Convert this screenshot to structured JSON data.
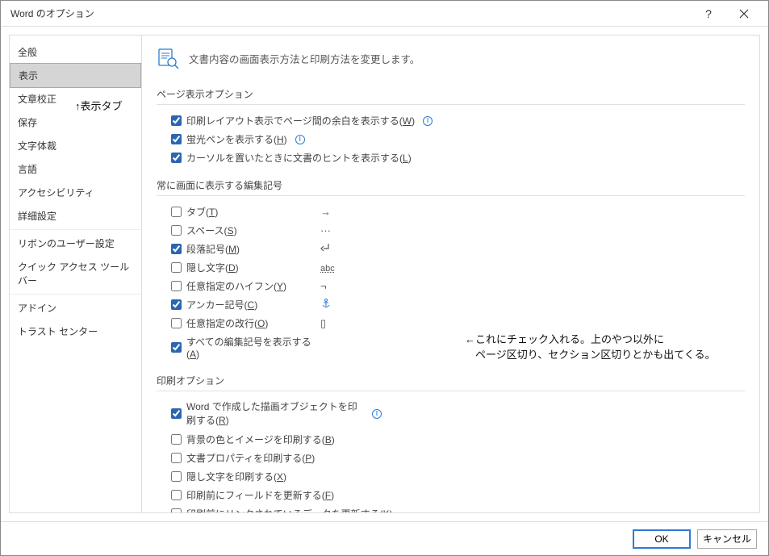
{
  "title": "Word のオプション",
  "sidebar": {
    "groups": [
      [
        "全般",
        "表示",
        "文章校正",
        "保存",
        "文字体裁",
        "言語",
        "アクセシビリティ",
        "詳細設定"
      ],
      [
        "リボンのユーザー設定",
        "クイック アクセス ツール バー"
      ],
      [
        "アドイン",
        "トラスト センター"
      ]
    ],
    "selected": "表示"
  },
  "heading": "文書内容の画面表示方法と印刷方法を変更します。",
  "sections": {
    "page_display": {
      "title": "ページ表示オプション",
      "items": [
        {
          "label_pre": "印刷レイアウト表示でページ間の余白を表示する(",
          "accel": "W",
          "label_post": ")",
          "checked": true,
          "info": true
        },
        {
          "label_pre": "蛍光ペンを表示する(",
          "accel": "H",
          "label_post": ")",
          "checked": true,
          "info": true
        },
        {
          "label_pre": "カーソルを置いたときに文書のヒントを表示する(",
          "accel": "L",
          "label_post": ")",
          "checked": true,
          "info": false
        }
      ]
    },
    "editing_marks": {
      "title": "常に画面に表示する編集記号",
      "items": [
        {
          "label_pre": "タブ(",
          "accel": "T",
          "label_post": ")",
          "checked": false,
          "sym": "→"
        },
        {
          "label_pre": "スペース(",
          "accel": "S",
          "label_post": ")",
          "checked": false,
          "sym": "···"
        },
        {
          "label_pre": "段落記号(",
          "accel": "M",
          "label_post": ")",
          "checked": true,
          "sym": "↵"
        },
        {
          "label_pre": "隠し文字(",
          "accel": "D",
          "label_post": ")",
          "checked": false,
          "sym": "abc"
        },
        {
          "label_pre": "任意指定のハイフン(",
          "accel": "Y",
          "label_post": ")",
          "checked": false,
          "sym": "¬"
        },
        {
          "label_pre": "アンカー記号(",
          "accel": "C",
          "label_post": ")",
          "checked": true,
          "sym": "⚓"
        },
        {
          "label_pre": "任意指定の改行(",
          "accel": "O",
          "label_post": ")",
          "checked": false,
          "sym": "▯"
        },
        {
          "label_pre": "すべての編集記号を表示する(",
          "accel": "A",
          "label_post": ")",
          "checked": true,
          "sym": ""
        }
      ]
    },
    "print": {
      "title": "印刷オプション",
      "items": [
        {
          "label_pre": "Word で作成した描画オブジェクトを印刷する(",
          "accel": "R",
          "label_post": ")",
          "checked": true,
          "info": true,
          "wrap": true
        },
        {
          "label_pre": "背景の色とイメージを印刷する(",
          "accel": "B",
          "label_post": ")",
          "checked": false
        },
        {
          "label_pre": "文書プロパティを印刷する(",
          "accel": "P",
          "label_post": ")",
          "checked": false
        },
        {
          "label_pre": "隠し文字を印刷する(",
          "accel": "X",
          "label_post": ")",
          "checked": false
        },
        {
          "label_pre": "印刷前にフィールドを更新する(",
          "accel": "F",
          "label_post": ")",
          "checked": false
        },
        {
          "label_pre": "印刷前にリンクされているデータを更新する(",
          "accel": "K",
          "label_post": ")",
          "checked": false
        }
      ]
    }
  },
  "annotations": {
    "sidebar": "↑表示タブ",
    "marks_line1": "←これにチェック入れる。上のやつ以外に",
    "marks_line2": "　ページ区切り、セクション区切りとかも出てくる。"
  },
  "footer": {
    "ok": "OK",
    "cancel": "キャンセル"
  }
}
